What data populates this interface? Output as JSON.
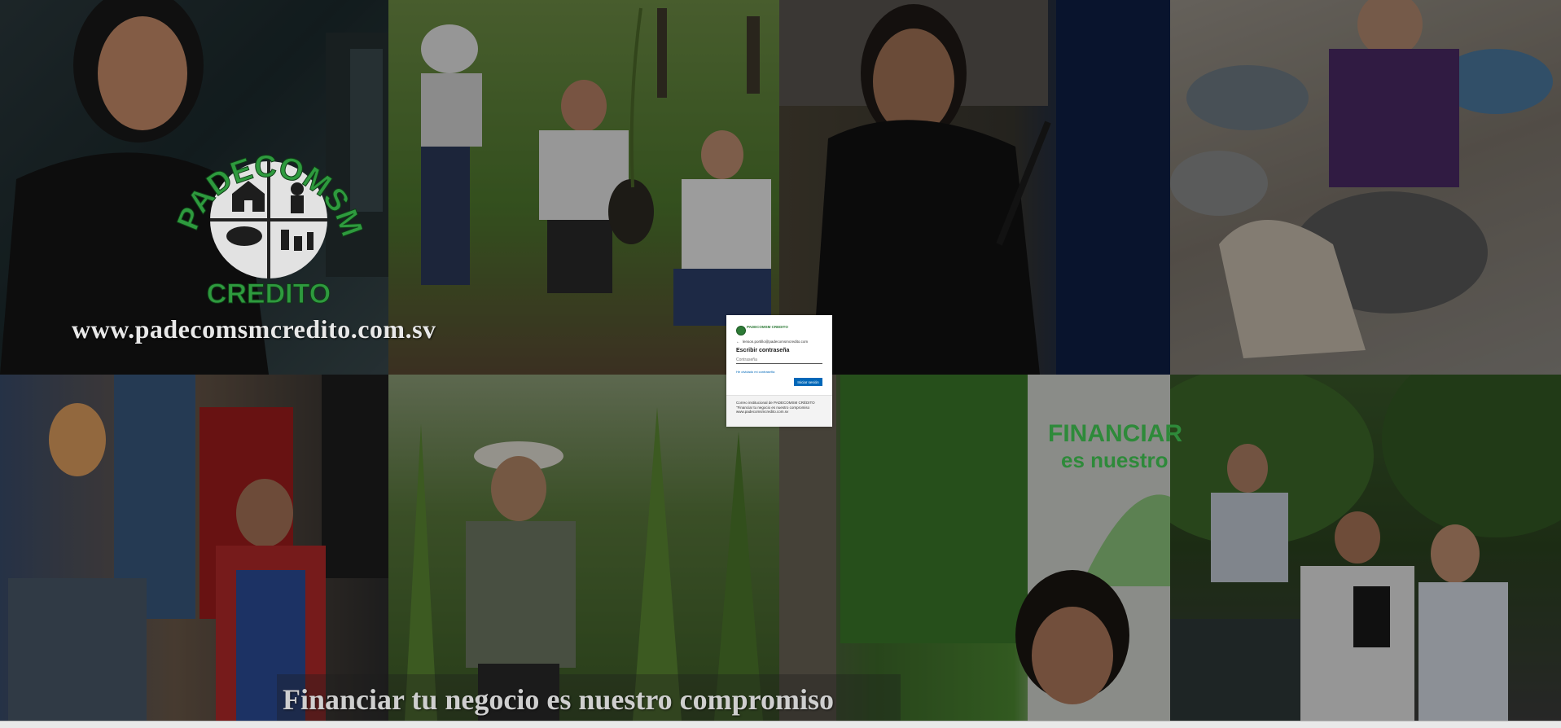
{
  "background": {
    "tiles": [
      {
        "name": "tile-credit-officer",
        "scene": "credit-officer"
      },
      {
        "name": "tile-tree-planting",
        "scene": "tree-planting"
      },
      {
        "name": "tile-weaver",
        "scene": "weaver"
      },
      {
        "name": "tile-potter",
        "scene": "potter"
      },
      {
        "name": "tile-shopkeeper",
        "scene": "shopkeeper"
      },
      {
        "name": "tile-farmer",
        "scene": "farmer"
      },
      {
        "name": "tile-office",
        "scene": "office"
      },
      {
        "name": "tile-seedlings",
        "scene": "seedlings"
      }
    ],
    "logo": {
      "top_text": "PADECOMSM",
      "bottom_text": "CREDITO",
      "color": "#2e9a3e"
    },
    "website": "www.padecomsmcredito.com.sv",
    "slogan": "Financiar tu negocio es nuestro compromiso",
    "office_sign": {
      "line1": "FINANCIAR",
      "line2": "es nuestro"
    }
  },
  "login": {
    "brand": "PADECOMSM CREDITO",
    "back_icon": "back-arrow-icon",
    "email": "lenson.portillo@padecomsmcredito.com",
    "title": "Escribir contraseña",
    "password_placeholder": "Contraseña",
    "forgot_link": "He olvidado mi contraseña",
    "signin_label": "Iniciar sesión",
    "description": "Correo institucional de PADECOMSM CRÉDITO \"Financiar tu negocio es nuestro compromiso www.padecomsmcredito.com.sv",
    "accent_color": "#0067b8"
  }
}
